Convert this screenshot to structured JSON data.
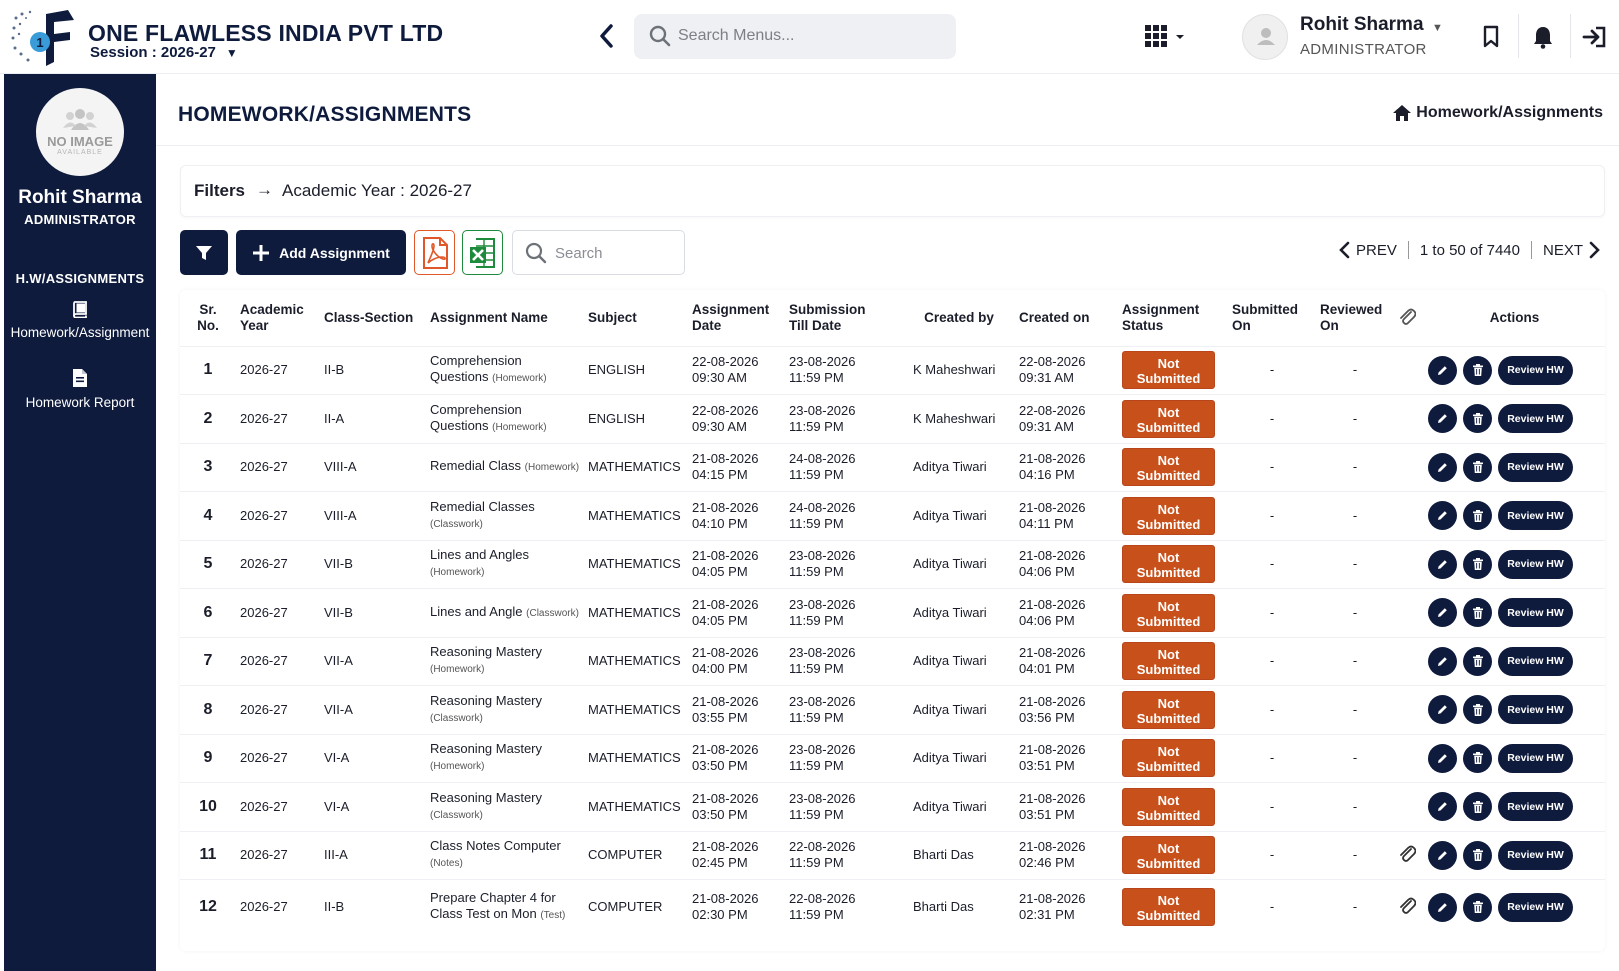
{
  "brand": {
    "name": "ONE FLAWLESS INDIA PVT LTD",
    "session_label": "Session : 2026-27"
  },
  "topbar": {
    "search_placeholder": "Search Menus...",
    "user_name": "Rohit Sharma",
    "user_role": "ADMINISTRATOR"
  },
  "sidebar": {
    "avatar_text": "NO IMAGE",
    "avatar_subtext": "AVAILABLE",
    "user_name": "Rohit Sharma",
    "user_role": "ADMINISTRATOR",
    "section": "H.W/ASSIGNMENTS",
    "items": [
      {
        "label": "Homework/Assignment",
        "icon": "book-icon"
      },
      {
        "label": "Homework Report",
        "icon": "document-icon"
      }
    ]
  },
  "page": {
    "title": "HOMEWORK/ASSIGNMENTS",
    "breadcrumb": "Homework/Assignments"
  },
  "filters": {
    "label": "Filters",
    "value": "Academic Year : 2026-27"
  },
  "toolbar": {
    "add_label": "Add Assignment",
    "search_placeholder": "Search"
  },
  "pager": {
    "prev": "PREV",
    "range": "1 to 50 of 7440",
    "next": "NEXT"
  },
  "table": {
    "headers": {
      "sr": [
        "Sr.",
        "No."
      ],
      "year": [
        "Academic",
        "Year"
      ],
      "class": "Class-Section",
      "name": "Assignment Name",
      "subject": "Subject",
      "adate": [
        "Assignment",
        "Date"
      ],
      "sdate": [
        "Submission",
        "Till Date"
      ],
      "created_by": "Created by",
      "created_on": "Created on",
      "status": [
        "Assignment",
        "Status"
      ],
      "submitted": [
        "Submitted",
        "On"
      ],
      "reviewed": [
        "Reviewed",
        "On"
      ],
      "actions": "Actions"
    },
    "review_label": "Review HW",
    "rows": [
      {
        "sr": "1",
        "year": "2026-27",
        "cls": "II-B",
        "name": "Comprehension Questions",
        "type": "(Homework)",
        "subject": "ENGLISH",
        "adate": "22-08-2026",
        "atime": "09:30 AM",
        "sdate": "23-08-2026",
        "stime": "11:59 PM",
        "by": "K Maheshwari",
        "cdate": "22-08-2026",
        "ctime": "09:31 AM",
        "status": [
          "Not",
          "Submitted"
        ],
        "submitted": "-",
        "reviewed": "-",
        "attachment": false
      },
      {
        "sr": "2",
        "year": "2026-27",
        "cls": "II-A",
        "name": "Comprehension Questions",
        "type": "(Homework)",
        "subject": "ENGLISH",
        "adate": "22-08-2026",
        "atime": "09:30 AM",
        "sdate": "23-08-2026",
        "stime": "11:59 PM",
        "by": "K Maheshwari",
        "cdate": "22-08-2026",
        "ctime": "09:31 AM",
        "status": [
          "Not",
          "Submitted"
        ],
        "submitted": "-",
        "reviewed": "-",
        "attachment": false
      },
      {
        "sr": "3",
        "year": "2026-27",
        "cls": "VIII-A",
        "name": "Remedial Class",
        "type": "(Homework)",
        "subject": "MATHEMATICS",
        "adate": "21-08-2026",
        "atime": "04:15 PM",
        "sdate": "24-08-2026",
        "stime": "11:59 PM",
        "by": "Aditya Tiwari",
        "cdate": "21-08-2026",
        "ctime": "04:16 PM",
        "status": [
          "Not",
          "Submitted"
        ],
        "submitted": "-",
        "reviewed": "-",
        "attachment": false
      },
      {
        "sr": "4",
        "year": "2026-27",
        "cls": "VIII-A",
        "name": "Remedial Classes",
        "type": "(Classwork)",
        "subject": "MATHEMATICS",
        "adate": "21-08-2026",
        "atime": "04:10 PM",
        "sdate": "24-08-2026",
        "stime": "11:59 PM",
        "by": "Aditya Tiwari",
        "cdate": "21-08-2026",
        "ctime": "04:11 PM",
        "status": [
          "Not",
          "Submitted"
        ],
        "submitted": "-",
        "reviewed": "-",
        "attachment": false
      },
      {
        "sr": "5",
        "year": "2026-27",
        "cls": "VII-B",
        "name": "Lines and Angles",
        "type": "(Homework)",
        "subject": "MATHEMATICS",
        "adate": "21-08-2026",
        "atime": "04:05 PM",
        "sdate": "23-08-2026",
        "stime": "11:59 PM",
        "by": "Aditya Tiwari",
        "cdate": "21-08-2026",
        "ctime": "04:06 PM",
        "status": [
          "Not",
          "Submitted"
        ],
        "submitted": "-",
        "reviewed": "-",
        "attachment": false
      },
      {
        "sr": "6",
        "year": "2026-27",
        "cls": "VII-B",
        "name": "Lines and Angle",
        "type": "(Classwork)",
        "subject": "MATHEMATICS",
        "adate": "21-08-2026",
        "atime": "04:05 PM",
        "sdate": "23-08-2026",
        "stime": "11:59 PM",
        "by": "Aditya Tiwari",
        "cdate": "21-08-2026",
        "ctime": "04:06 PM",
        "status": [
          "Not",
          "Submitted"
        ],
        "submitted": "-",
        "reviewed": "-",
        "attachment": false
      },
      {
        "sr": "7",
        "year": "2026-27",
        "cls": "VII-A",
        "name": "Reasoning Mastery",
        "type": "(Homework)",
        "subject": "MATHEMATICS",
        "adate": "21-08-2026",
        "atime": "04:00 PM",
        "sdate": "23-08-2026",
        "stime": "11:59 PM",
        "by": "Aditya Tiwari",
        "cdate": "21-08-2026",
        "ctime": "04:01 PM",
        "status": [
          "Not",
          "Submitted"
        ],
        "submitted": "-",
        "reviewed": "-",
        "attachment": false
      },
      {
        "sr": "8",
        "year": "2026-27",
        "cls": "VII-A",
        "name": "Reasoning Mastery",
        "type": "(Classwork)",
        "subject": "MATHEMATICS",
        "adate": "21-08-2026",
        "atime": "03:55 PM",
        "sdate": "23-08-2026",
        "stime": "11:59 PM",
        "by": "Aditya Tiwari",
        "cdate": "21-08-2026",
        "ctime": "03:56 PM",
        "status": [
          "Not",
          "Submitted"
        ],
        "submitted": "-",
        "reviewed": "-",
        "attachment": false
      },
      {
        "sr": "9",
        "year": "2026-27",
        "cls": "VI-A",
        "name": "Reasoning Mastery",
        "type": "(Homework)",
        "subject": "MATHEMATICS",
        "adate": "21-08-2026",
        "atime": "03:50 PM",
        "sdate": "23-08-2026",
        "stime": "11:59 PM",
        "by": "Aditya Tiwari",
        "cdate": "21-08-2026",
        "ctime": "03:51 PM",
        "status": [
          "Not",
          "Submitted"
        ],
        "submitted": "-",
        "reviewed": "-",
        "attachment": false
      },
      {
        "sr": "10",
        "year": "2026-27",
        "cls": "VI-A",
        "name": "Reasoning Mastery",
        "type": "(Classwork)",
        "subject": "MATHEMATICS",
        "adate": "21-08-2026",
        "atime": "03:50 PM",
        "sdate": "23-08-2026",
        "stime": "11:59 PM",
        "by": "Aditya Tiwari",
        "cdate": "21-08-2026",
        "ctime": "03:51 PM",
        "status": [
          "Not",
          "Submitted"
        ],
        "submitted": "-",
        "reviewed": "-",
        "attachment": false
      },
      {
        "sr": "11",
        "year": "2026-27",
        "cls": "III-A",
        "name": "Class Notes Computer",
        "type": "(Notes)",
        "subject": "COMPUTER",
        "adate": "21-08-2026",
        "atime": "02:45 PM",
        "sdate": "22-08-2026",
        "stime": "11:59 PM",
        "by": "Bharti Das",
        "cdate": "21-08-2026",
        "ctime": "02:46 PM",
        "status": [
          "Not",
          "Submitted"
        ],
        "submitted": "-",
        "reviewed": "-",
        "attachment": true
      },
      {
        "sr": "12",
        "year": "2026-27",
        "cls": "II-B",
        "name": "Prepare Chapter 4 for Class Test on Mon",
        "type": "(Test)",
        "subject": "COMPUTER",
        "adate": "21-08-2026",
        "atime": "02:30 PM",
        "sdate": "22-08-2026",
        "stime": "11:59 PM",
        "by": "Bharti Das",
        "cdate": "21-08-2026",
        "ctime": "02:31 PM",
        "status": [
          "Not",
          "Submitted"
        ],
        "submitted": "-",
        "reviewed": "-",
        "attachment": true
      }
    ]
  },
  "colors": {
    "navy": "#0e1b3d",
    "status_orange": "#c8501b",
    "pdf_red": "#e0582a",
    "excel_green": "#1e8a3c"
  }
}
